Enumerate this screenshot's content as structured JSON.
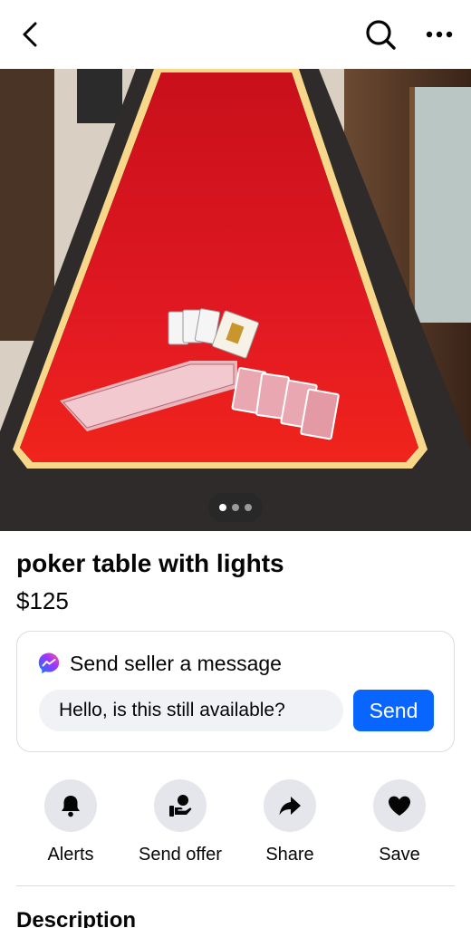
{
  "header": {
    "back_icon": "chevron-left-icon",
    "search_icon": "search-icon",
    "more_icon": "more-horizontal-icon"
  },
  "photo": {
    "alt": "Poker table with red felt and LED lights, playing cards on the table",
    "page_count": 3,
    "active_page": 1
  },
  "listing": {
    "title": "poker table with lights",
    "price": "$125"
  },
  "message": {
    "icon": "messenger-icon",
    "title": "Send seller a message",
    "input_value": "Hello, is this still available?",
    "send_label": "Send"
  },
  "actions": [
    {
      "label": "Alerts",
      "icon": "bell-icon"
    },
    {
      "label": "Send offer",
      "icon": "offer-hand-icon"
    },
    {
      "label": "Share",
      "icon": "share-arrow-icon"
    },
    {
      "label": "Save",
      "icon": "heart-icon"
    }
  ],
  "description": {
    "heading": "Description"
  },
  "colors": {
    "accent": "#0866ff",
    "felt": "#d8141c",
    "chip_bg": "#e4e6eb"
  }
}
